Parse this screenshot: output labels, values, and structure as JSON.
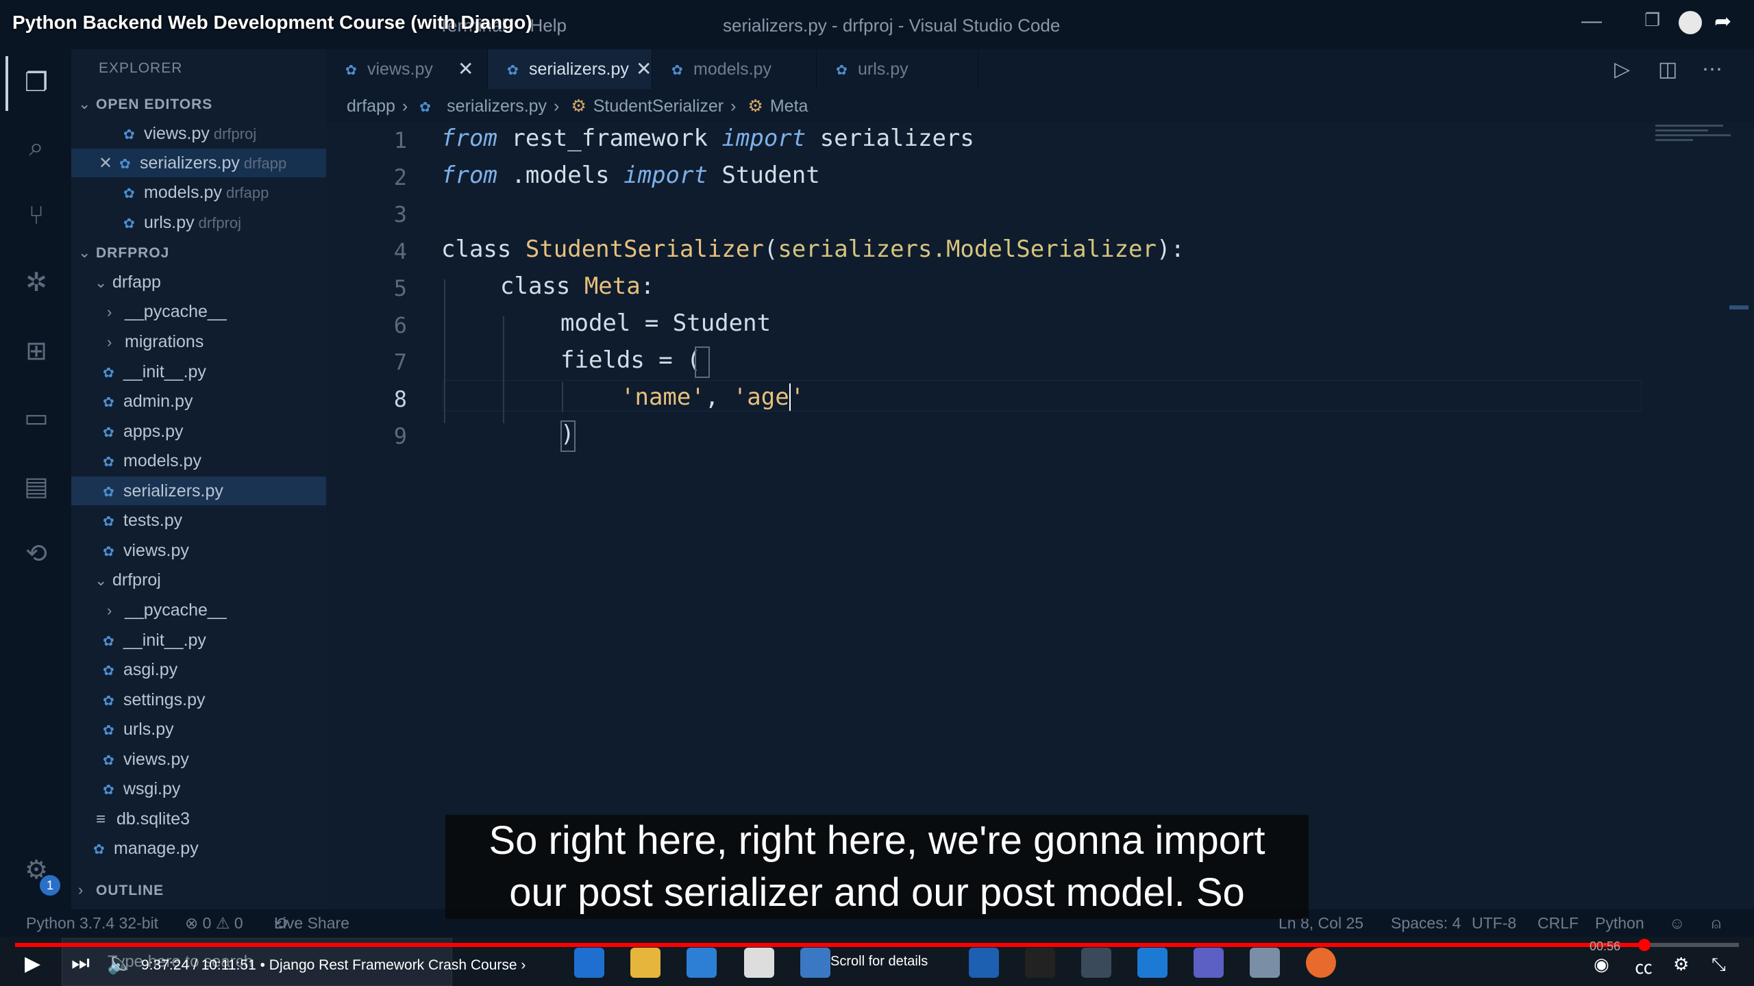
{
  "video": {
    "title": "Python Backend Web Development Course (with Django)",
    "time": "9:37:24 / 10:11:51 • Django Rest Framework Crash Course ›",
    "scroll_details": "Scroll for details",
    "progress_fraction": 0.945
  },
  "window": {
    "menu": [
      "Terminal",
      "Help"
    ],
    "title": "serializers.py - drfproj - Visual Studio Code"
  },
  "explorer": {
    "header": "EXPLORER",
    "open_editors_label": "OPEN EDITORS",
    "open_editors": [
      {
        "name": "views.py",
        "folder": "drfproj"
      },
      {
        "name": "serializers.py",
        "folder": "drfapp"
      },
      {
        "name": "models.py",
        "folder": "drfapp"
      },
      {
        "name": "urls.py",
        "folder": "drfproj"
      }
    ],
    "project_label": "DRFPROJ",
    "tree": [
      {
        "name": "drfapp",
        "kind": "folder-open"
      },
      {
        "name": "__pycache__",
        "kind": "folder"
      },
      {
        "name": "migrations",
        "kind": "folder"
      },
      {
        "name": "__init__.py",
        "kind": "py"
      },
      {
        "name": "admin.py",
        "kind": "py"
      },
      {
        "name": "apps.py",
        "kind": "py"
      },
      {
        "name": "models.py",
        "kind": "py"
      },
      {
        "name": "serializers.py",
        "kind": "py"
      },
      {
        "name": "tests.py",
        "kind": "py"
      },
      {
        "name": "views.py",
        "kind": "py"
      },
      {
        "name": "drfproj",
        "kind": "folder-open"
      },
      {
        "name": "__pycache__",
        "kind": "folder"
      },
      {
        "name": "__init__.py",
        "kind": "py"
      },
      {
        "name": "asgi.py",
        "kind": "py"
      },
      {
        "name": "settings.py",
        "kind": "py"
      },
      {
        "name": "urls.py",
        "kind": "py"
      },
      {
        "name": "views.py",
        "kind": "py"
      },
      {
        "name": "wsgi.py",
        "kind": "py"
      },
      {
        "name": "db.sqlite3",
        "kind": "db"
      },
      {
        "name": "manage.py",
        "kind": "py"
      }
    ],
    "outline_label": "OUTLINE"
  },
  "tabs": [
    {
      "label": "views.py"
    },
    {
      "label": "serializers.py"
    },
    {
      "label": "models.py"
    },
    {
      "label": "urls.py"
    }
  ],
  "breadcrumb": [
    "drfapp",
    "serializers.py",
    "StudentSerializer",
    "Meta"
  ],
  "code": {
    "line_numbers": [
      "1",
      "2",
      "3",
      "4",
      "5",
      "6",
      "7",
      "8",
      "9"
    ],
    "l1": {
      "kw1": "from",
      "mod": " rest_framework ",
      "kw2": "import",
      "name": " serializers"
    },
    "l2": {
      "kw1": "from",
      "mod": " .models ",
      "kw2": "import",
      "name": " Student"
    },
    "l4": {
      "kw": "class ",
      "cls": "StudentSerializer",
      "p1": "(",
      "base": "serializers.ModelSerializer",
      "p2": "):"
    },
    "l5": {
      "kw": "class ",
      "cls": "Meta",
      "p": ":"
    },
    "l6": {
      "text": "model = Student"
    },
    "l7": {
      "text": "fields = ",
      "br": "("
    },
    "l8": {
      "s1": "'name'",
      "sep": ", ",
      "s2": "'age",
      "s3": "'"
    },
    "l9": {
      "br": ")"
    }
  },
  "statusbar": {
    "python": "Python 3.7.4 32-bit",
    "problems": "⊗ 0 ⚠ 0",
    "live_share": "Live Share",
    "position": "Ln 8, Col 25",
    "spaces": "Spaces: 4",
    "encoding": "UTF-8",
    "eol": "CRLF",
    "language": "Python"
  },
  "caption": {
    "line1": "So right here, right here, we're gonna import",
    "line2": "our post serializer and our post model. So"
  },
  "taskbar": {
    "search_placeholder": "Type here to search",
    "clock_partial": "00:56"
  },
  "colors": {
    "editor_bg": "#0e1c2e",
    "keyword": "#7fb0e8",
    "class_name": "#e8c07d",
    "progress": "#ff0000"
  }
}
